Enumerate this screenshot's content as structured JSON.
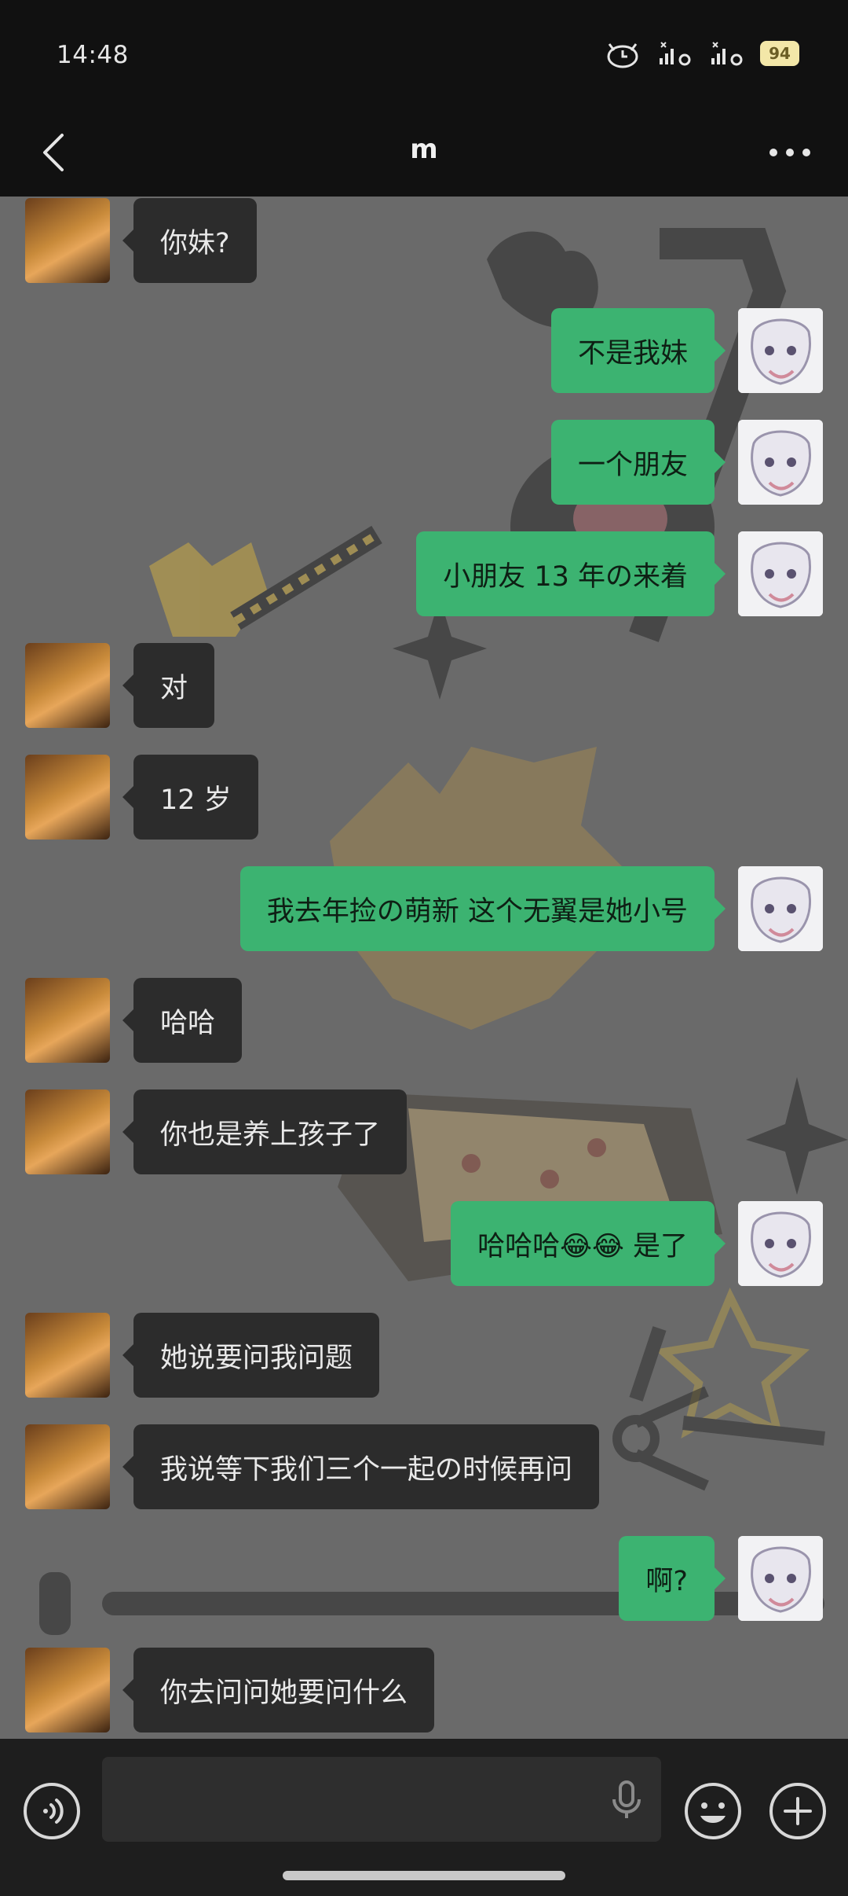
{
  "status_bar": {
    "time": "14:48",
    "battery": "94"
  },
  "header": {
    "title": "m"
  },
  "colors": {
    "self_bubble": "#3cb371",
    "peer_bubble": "#2c2c2c"
  },
  "messages": [
    {
      "side": "left",
      "text": "你妹?"
    },
    {
      "side": "right",
      "text": "不是我妹"
    },
    {
      "side": "right",
      "text": "一个朋友"
    },
    {
      "side": "right",
      "text": "小朋友  13 年の来着"
    },
    {
      "side": "left",
      "text": "对"
    },
    {
      "side": "left",
      "text": " 12 岁"
    },
    {
      "side": "right",
      "text": "我去年捡の萌新   这个无翼是她小号"
    },
    {
      "side": "left",
      "text": "哈哈"
    },
    {
      "side": "left",
      "text": "你也是养上孩子了"
    },
    {
      "side": "right",
      "text": "哈哈哈😂😂   是了"
    },
    {
      "side": "left",
      "text": "她说要问我问题"
    },
    {
      "side": "left",
      "text": "我说等下我们三个一起の时候再问"
    },
    {
      "side": "right",
      "text": "啊?"
    },
    {
      "side": "left",
      "text": "你去问问她要问什么"
    }
  ],
  "input": {
    "placeholder": ""
  }
}
